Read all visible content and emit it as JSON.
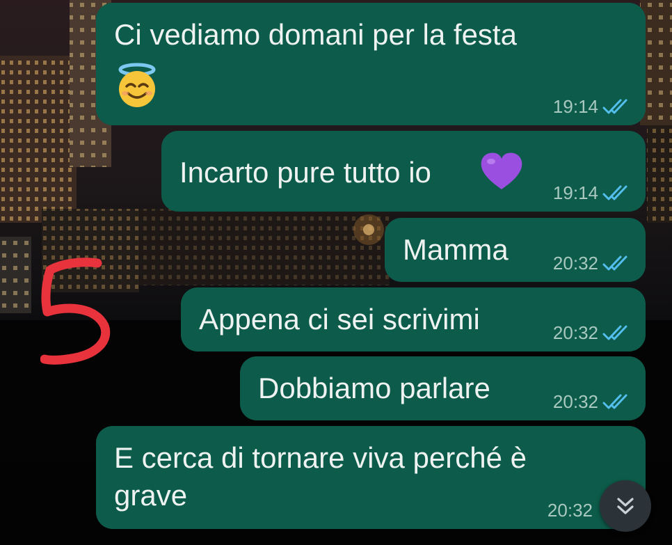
{
  "colors": {
    "bubble": "#0d5c4b",
    "read_ticks": "#53bdeb",
    "timestamp": "#a9c8bf",
    "scribble": "#e8323c"
  },
  "messages": [
    {
      "text_line1": "Ci vediamo domani per la festa",
      "emoji": "smiling-face-with-halo",
      "time": "19:14",
      "status": "read"
    },
    {
      "text": "Incarto pure tutto io",
      "emoji": "purple-heart",
      "time": "19:14",
      "status": "read"
    },
    {
      "text": "Mamma",
      "time": "20:32",
      "status": "read"
    },
    {
      "text": "Appena ci sei scrivimi",
      "time": "20:32",
      "status": "read"
    },
    {
      "text": "Dobbiamo parlare",
      "time": "20:32",
      "status": "read"
    },
    {
      "text_line1": "E cerca di tornare viva perché è",
      "text_line2": "grave",
      "time": "20:32",
      "status": "read"
    }
  ],
  "annotation": {
    "text": "5"
  },
  "scroll_button": {
    "icon": "double-chevron-down-icon"
  }
}
